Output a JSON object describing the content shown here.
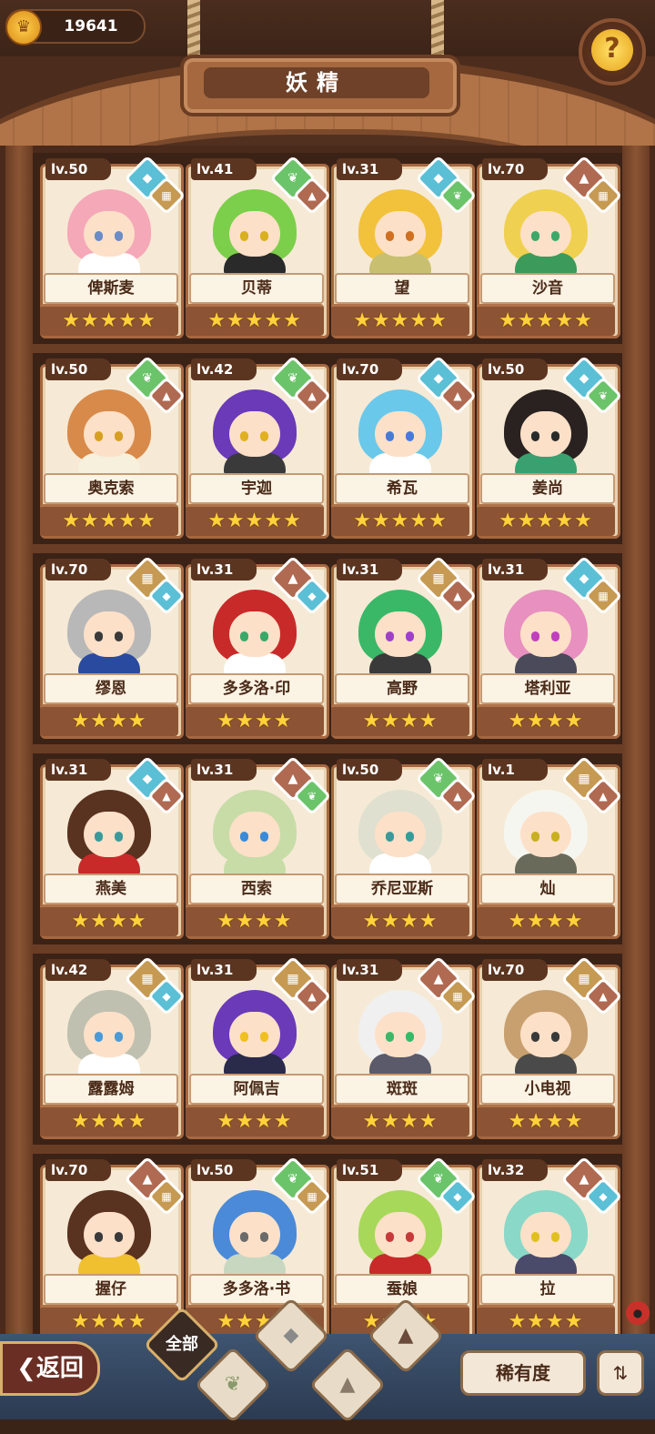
{
  "header": {
    "currency": "19641",
    "title": "妖精",
    "help_icon": "question-bulb-icon"
  },
  "fairies": [
    {
      "level": "lv.50",
      "name": "俾斯麦",
      "stars": 5,
      "el1": "water",
      "el2": "earth",
      "hair": "#f5a8b8",
      "body": "#ffffff",
      "eye": "#6a8cc8"
    },
    {
      "level": "lv.41",
      "name": "贝蒂",
      "stars": 5,
      "el1": "leaf",
      "el2": "mountain",
      "hair": "#7ccf4a",
      "body": "#2a2a2a",
      "eye": "#d8b020"
    },
    {
      "level": "lv.31",
      "name": "望",
      "stars": 5,
      "el1": "water",
      "el2": "leaf",
      "hair": "#f2c23c",
      "body": "#c8c070",
      "eye": "#d07020"
    },
    {
      "level": "lv.70",
      "name": "沙音",
      "stars": 5,
      "el1": "mountain",
      "el2": "earth",
      "hair": "#f0d050",
      "body": "#3c9a5a",
      "eye": "#3ca86a"
    },
    {
      "level": "lv.50",
      "name": "奥克索",
      "stars": 5,
      "el1": "leaf",
      "el2": "mountain",
      "hair": "#d88a4a",
      "body": "#f6f0dc",
      "eye": "#d8a020"
    },
    {
      "level": "lv.42",
      "name": "宇迦",
      "stars": 5,
      "el1": "leaf",
      "el2": "mountain",
      "hair": "#6a3ab8",
      "body": "#3a3a3a",
      "eye": "#e0b020"
    },
    {
      "level": "lv.70",
      "name": "希瓦",
      "stars": 5,
      "el1": "water",
      "el2": "mountain",
      "hair": "#6ac8ea",
      "body": "#ffffff",
      "eye": "#4a7ad8"
    },
    {
      "level": "lv.50",
      "name": "姜尚",
      "stars": 5,
      "el1": "water",
      "el2": "leaf",
      "hair": "#2a2220",
      "body": "#3aa070",
      "eye": "#2a2a2a"
    },
    {
      "level": "lv.70",
      "name": "缪恩",
      "stars": 4,
      "el1": "earth",
      "el2": "water",
      "hair": "#b8b8b8",
      "body": "#2a4aa0",
      "eye": "#3a3a3a"
    },
    {
      "level": "lv.31",
      "name": "多多洛·印",
      "stars": 4,
      "el1": "mountain",
      "el2": "water",
      "hair": "#c82a2a",
      "body": "#ffffff",
      "eye": "#3aa868"
    },
    {
      "level": "lv.31",
      "name": "高野",
      "stars": 4,
      "el1": "earth",
      "el2": "mountain",
      "hair": "#3ab868",
      "body": "#3a3a3a",
      "eye": "#a040c8"
    },
    {
      "level": "lv.31",
      "name": "塔利亚",
      "stars": 4,
      "el1": "water",
      "el2": "earth",
      "hair": "#e890c0",
      "body": "#4a4a5a",
      "eye": "#c040c0"
    },
    {
      "level": "lv.31",
      "name": "燕美",
      "stars": 4,
      "el1": "water",
      "el2": "mountain",
      "hair": "#5a3220",
      "body": "#c82a2a",
      "eye": "#3a9a9a"
    },
    {
      "level": "lv.31",
      "name": "西索",
      "stars": 4,
      "el1": "mountain",
      "el2": "leaf",
      "hair": "#c8dca8",
      "body": "#c8dca8",
      "eye": "#3a8ad8"
    },
    {
      "level": "lv.50",
      "name": "乔尼亚斯",
      "stars": 4,
      "el1": "leaf",
      "el2": "mountain",
      "hair": "#e0e0d0",
      "body": "#ffffff",
      "eye": "#3a9a9a"
    },
    {
      "level": "lv.1",
      "name": "灿",
      "stars": 4,
      "el1": "earth",
      "el2": "mountain",
      "hair": "#f6f6f0",
      "body": "#6a6a5a",
      "eye": "#c8b020"
    },
    {
      "level": "lv.42",
      "name": "露露姆",
      "stars": 4,
      "el1": "earth",
      "el2": "water",
      "hair": "#c0c0b0",
      "body": "#ffffff",
      "eye": "#4a9ad8"
    },
    {
      "level": "lv.31",
      "name": "阿佩吉",
      "stars": 4,
      "el1": "earth",
      "el2": "mountain",
      "hair": "#6a3ab8",
      "body": "#2a2a4a",
      "eye": "#f0c020"
    },
    {
      "level": "lv.31",
      "name": "斑斑",
      "stars": 4,
      "el1": "mountain",
      "el2": "earth",
      "hair": "#f0f0f0",
      "body": "#5a5a6a",
      "eye": "#3ab868"
    },
    {
      "level": "lv.70",
      "name": "小电视",
      "stars": 4,
      "el1": "earth",
      "el2": "mountain",
      "hair": "#c8a070",
      "body": "#4a4a4a",
      "eye": "#3a3a3a"
    },
    {
      "level": "lv.70",
      "name": "握仔",
      "stars": 4,
      "el1": "mountain",
      "el2": "earth",
      "hair": "#5a3220",
      "body": "#f0c030",
      "eye": "#3a3a3a"
    },
    {
      "level": "lv.50",
      "name": "多多洛·书",
      "stars": 4,
      "el1": "leaf",
      "el2": "earth",
      "hair": "#4a8ad8",
      "body": "#c8d8c0",
      "eye": "#6a6a6a"
    },
    {
      "level": "lv.51",
      "name": "蚕娘",
      "stars": 4,
      "el1": "leaf",
      "el2": "water",
      "hair": "#a8d85a",
      "body": "#c82a2a",
      "eye": "#c83a3a"
    },
    {
      "level": "lv.32",
      "name": "拉",
      "stars": 4,
      "el1": "mountain",
      "el2": "water",
      "hair": "#8ad8c8",
      "body": "#4a4a6a",
      "eye": "#e0c020"
    }
  ],
  "footer": {
    "back_label": "返回",
    "filter_all_label": "全部",
    "rarity_label": "稀有度",
    "filter_icons": [
      "water-drop-icon",
      "sprout-icon",
      "mountain-icon",
      "mountain-snow-icon"
    ]
  }
}
